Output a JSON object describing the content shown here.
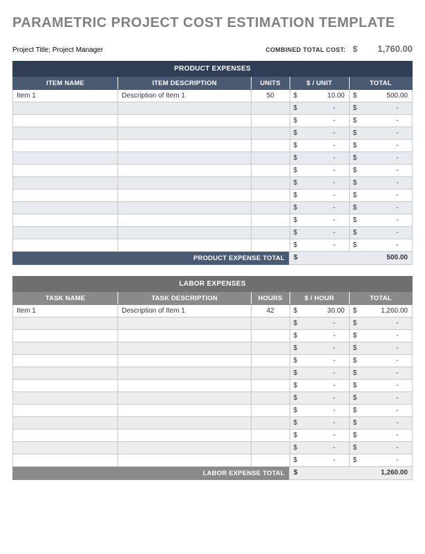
{
  "title": "PARAMETRIC PROJECT COST ESTIMATION TEMPLATE",
  "meta": {
    "project_line": "Project Title; Project Manager",
    "combined_label": "COMBINED TOTAL COST:",
    "currency": "$",
    "combined_amount": "1,760.00"
  },
  "product": {
    "section_title": "PRODUCT EXPENSES",
    "headers": {
      "c1": "ITEM NAME",
      "c2": "ITEM DESCRIPTION",
      "c3": "UNITS",
      "c4": "$ / UNIT",
      "c5": "TOTAL"
    },
    "rows": [
      {
        "name": "Item 1",
        "desc": "Description of Item 1",
        "units": "50",
        "rate": "10.00",
        "total": "500.00"
      },
      {
        "name": "",
        "desc": "",
        "units": "",
        "rate": "-",
        "total": "-"
      },
      {
        "name": "",
        "desc": "",
        "units": "",
        "rate": "-",
        "total": "-"
      },
      {
        "name": "",
        "desc": "",
        "units": "",
        "rate": "-",
        "total": "-"
      },
      {
        "name": "",
        "desc": "",
        "units": "",
        "rate": "-",
        "total": "-"
      },
      {
        "name": "",
        "desc": "",
        "units": "",
        "rate": "-",
        "total": "-"
      },
      {
        "name": "",
        "desc": "",
        "units": "",
        "rate": "-",
        "total": "-"
      },
      {
        "name": "",
        "desc": "",
        "units": "",
        "rate": "-",
        "total": "-"
      },
      {
        "name": "",
        "desc": "",
        "units": "",
        "rate": "-",
        "total": "-"
      },
      {
        "name": "",
        "desc": "",
        "units": "",
        "rate": "-",
        "total": "-"
      },
      {
        "name": "",
        "desc": "",
        "units": "",
        "rate": "-",
        "total": "-"
      },
      {
        "name": "",
        "desc": "",
        "units": "",
        "rate": "-",
        "total": "-"
      },
      {
        "name": "",
        "desc": "",
        "units": "",
        "rate": "-",
        "total": "-"
      }
    ],
    "total_label": "PRODUCT EXPENSE TOTAL",
    "total_value": "500.00"
  },
  "labor": {
    "section_title": "LABOR EXPENSES",
    "headers": {
      "c1": "TASK NAME",
      "c2": "TASK DESCRIPTION",
      "c3": "HOURS",
      "c4": "$ / HOUR",
      "c5": "TOTAL"
    },
    "rows": [
      {
        "name": "Item 1",
        "desc": "Description of Item 1",
        "units": "42",
        "rate": "30.00",
        "total": "1,260.00"
      },
      {
        "name": "",
        "desc": "",
        "units": "",
        "rate": "-",
        "total": "-"
      },
      {
        "name": "",
        "desc": "",
        "units": "",
        "rate": "-",
        "total": "-"
      },
      {
        "name": "",
        "desc": "",
        "units": "",
        "rate": "-",
        "total": "-"
      },
      {
        "name": "",
        "desc": "",
        "units": "",
        "rate": "-",
        "total": "-"
      },
      {
        "name": "",
        "desc": "",
        "units": "",
        "rate": "-",
        "total": "-"
      },
      {
        "name": "",
        "desc": "",
        "units": "",
        "rate": "-",
        "total": "-"
      },
      {
        "name": "",
        "desc": "",
        "units": "",
        "rate": "-",
        "total": "-"
      },
      {
        "name": "",
        "desc": "",
        "units": "",
        "rate": "-",
        "total": "-"
      },
      {
        "name": "",
        "desc": "",
        "units": "",
        "rate": "-",
        "total": "-"
      },
      {
        "name": "",
        "desc": "",
        "units": "",
        "rate": "-",
        "total": "-"
      },
      {
        "name": "",
        "desc": "",
        "units": "",
        "rate": "-",
        "total": "-"
      },
      {
        "name": "",
        "desc": "",
        "units": "",
        "rate": "-",
        "total": "-"
      }
    ],
    "total_label": "LABOR EXPENSE TOTAL",
    "total_value": "1,260.00"
  }
}
